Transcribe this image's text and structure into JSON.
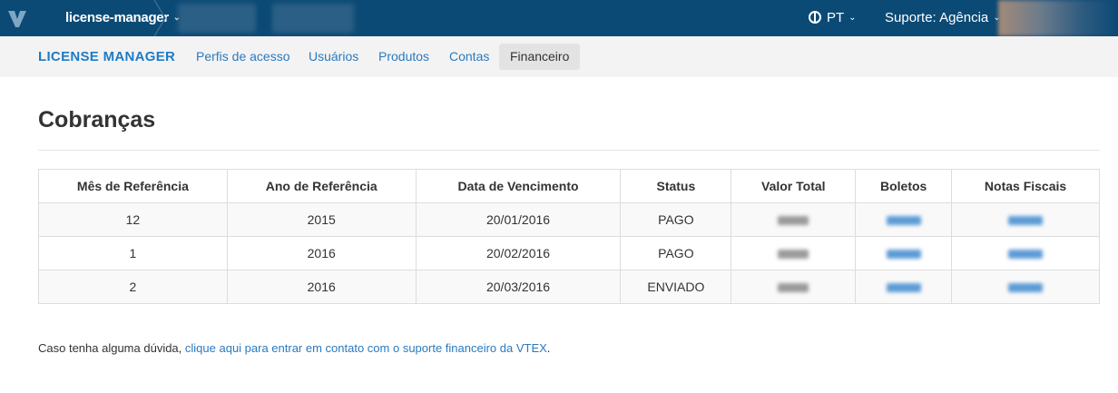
{
  "topbar": {
    "account_name": "license-manager",
    "language": "PT",
    "support_label": "Suporte:",
    "support_value": "Agência"
  },
  "subnav": {
    "brand": "LICENSE MANAGER",
    "items": [
      {
        "label": "Perfis de acesso",
        "active": false
      },
      {
        "label": "Usuários",
        "active": false
      },
      {
        "label": "Produtos",
        "active": false
      },
      {
        "label": "Contas",
        "active": false
      },
      {
        "label": "Financeiro",
        "active": true
      }
    ]
  },
  "page": {
    "title": "Cobranças"
  },
  "table": {
    "headers": [
      "Mês de Referência",
      "Ano de Referência",
      "Data de Vencimento",
      "Status",
      "Valor Total",
      "Boletos",
      "Notas Fiscais"
    ],
    "rows": [
      {
        "month": "12",
        "year": "2015",
        "due_date": "20/01/2016",
        "status": "PAGO"
      },
      {
        "month": "1",
        "year": "2016",
        "due_date": "20/02/2016",
        "status": "PAGO"
      },
      {
        "month": "2",
        "year": "2016",
        "due_date": "20/03/2016",
        "status": "ENVIADO"
      }
    ]
  },
  "footer": {
    "text": "Caso tenha alguma dúvida,",
    "link": "clique aqui para entrar em contato com o suporte financeiro da VTEX",
    "trailing": "."
  },
  "icons": {
    "logo": "vtex-logo-icon",
    "language": "globe-icon",
    "dropdown": "chevron-down-icon"
  },
  "colors": {
    "topbar_bg": "#0b4a75",
    "link": "#2a7ac0",
    "brand": "#1d7bc7"
  }
}
